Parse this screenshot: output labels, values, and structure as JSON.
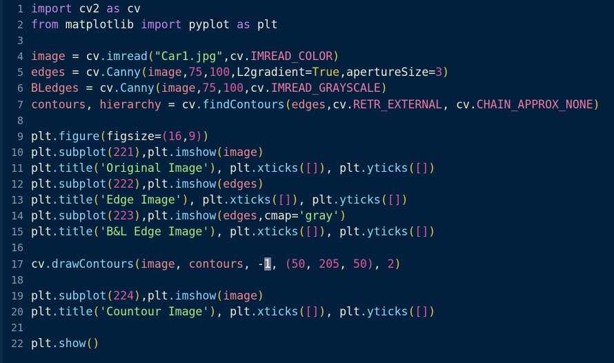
{
  "editor": {
    "background_color": "#04203f",
    "language": "python",
    "total_lines": 22,
    "selection": {
      "text": "1",
      "line": 17,
      "highlight_color": "#7a8290"
    },
    "colors": {
      "keyword": "#c586e8",
      "function": "#8fd6f7",
      "string": "#aee87a",
      "number": "#e05a94",
      "variable": "#f08a8a",
      "paren": "#e8c547",
      "bracket": "#e05a94",
      "constant": "#f07a9e",
      "text": "#f2ead3",
      "line_number": "#9aa7b8"
    }
  },
  "lines": [
    {
      "n": "1",
      "text": "import cv2 as cv"
    },
    {
      "n": "2",
      "text": "from matplotlib import pyplot as plt"
    },
    {
      "n": "3",
      "text": ""
    },
    {
      "n": "4",
      "text": "image = cv.imread(\"Car1.jpg\",cv.IMREAD_COLOR)"
    },
    {
      "n": "5",
      "text": "edges = cv.Canny(image,75,100,L2gradient=True,apertureSize=3)"
    },
    {
      "n": "6",
      "text": "BLedges = cv.Canny(image,75,100,cv.IMREAD_GRAYSCALE)"
    },
    {
      "n": "7",
      "text": "contours, hierarchy = cv.findContours(edges,cv.RETR_EXTERNAL, cv.CHAIN_APPROX_NONE)"
    },
    {
      "n": "8",
      "text": ""
    },
    {
      "n": "9",
      "text": "plt.figure(figsize=(16,9))"
    },
    {
      "n": "10",
      "text": "plt.subplot(221),plt.imshow(image)"
    },
    {
      "n": "11",
      "text": "plt.title('Original Image'), plt.xticks([]), plt.yticks([])"
    },
    {
      "n": "12",
      "text": "plt.subplot(222),plt.imshow(edges)"
    },
    {
      "n": "13",
      "text": "plt.title('Edge Image'), plt.xticks([]), plt.yticks([])"
    },
    {
      "n": "14",
      "text": "plt.subplot(223),plt.imshow(edges,cmap='gray')"
    },
    {
      "n": "15",
      "text": "plt.title('B&L Edge Image'), plt.xticks([]), plt.yticks([])"
    },
    {
      "n": "16",
      "text": ""
    },
    {
      "n": "17",
      "text": "cv.drawContours(image, contours, -1, (50, 205, 50), 2)"
    },
    {
      "n": "18",
      "text": ""
    },
    {
      "n": "19",
      "text": "plt.subplot(224),plt.imshow(image)"
    },
    {
      "n": "20",
      "text": "plt.title('Countour Image'), plt.xticks([]), plt.yticks([])"
    },
    {
      "n": "21",
      "text": ""
    },
    {
      "n": "22",
      "text": "plt.show()"
    }
  ],
  "tokens": {
    "l1": [
      [
        "import",
        "t-kw"
      ],
      [
        " ",
        "t-plain"
      ],
      [
        "cv2",
        "t-plain"
      ],
      [
        " ",
        "t-plain"
      ],
      [
        "as",
        "t-kw"
      ],
      [
        " ",
        "t-plain"
      ],
      [
        "cv",
        "t-plain"
      ]
    ],
    "l2": [
      [
        "from",
        "t-kw"
      ],
      [
        " ",
        "t-plain"
      ],
      [
        "matplotlib",
        "t-plain"
      ],
      [
        " ",
        "t-plain"
      ],
      [
        "import",
        "t-kw"
      ],
      [
        " ",
        "t-plain"
      ],
      [
        "pyplot",
        "t-plain"
      ],
      [
        " ",
        "t-plain"
      ],
      [
        "as",
        "t-kw"
      ],
      [
        " ",
        "t-plain"
      ],
      [
        "plt",
        "t-plain"
      ]
    ],
    "l3": [],
    "l4": [
      [
        "image",
        "t-const"
      ],
      [
        " = ",
        "t-plain"
      ],
      [
        "cv",
        "t-plain"
      ],
      [
        ".imread",
        "t-fn"
      ],
      [
        "(",
        "t-paren"
      ],
      [
        "\"Car1.jpg\"",
        "t-str"
      ],
      [
        ",",
        "t-plain"
      ],
      [
        "cv",
        "t-plain"
      ],
      [
        ".",
        "t-plain"
      ],
      [
        "IMREAD_COLOR",
        "t-attr"
      ],
      [
        ")",
        "t-paren"
      ]
    ],
    "l5": [
      [
        "edges",
        "t-const"
      ],
      [
        " = ",
        "t-plain"
      ],
      [
        "cv",
        "t-plain"
      ],
      [
        ".Canny",
        "t-fn"
      ],
      [
        "(",
        "t-paren"
      ],
      [
        "image",
        "t-const"
      ],
      [
        ",",
        "t-plain"
      ],
      [
        "75",
        "t-num"
      ],
      [
        ",",
        "t-plain"
      ],
      [
        "100",
        "t-num"
      ],
      [
        ",",
        "t-plain"
      ],
      [
        "L2gradient",
        "t-plain"
      ],
      [
        "=",
        "t-plain"
      ],
      [
        "True",
        "t-bool"
      ],
      [
        ",",
        "t-plain"
      ],
      [
        "apertureSize",
        "t-plain"
      ],
      [
        "=",
        "t-plain"
      ],
      [
        "3",
        "t-num"
      ],
      [
        ")",
        "t-paren"
      ]
    ],
    "l6": [
      [
        "BLedges",
        "t-const"
      ],
      [
        " = ",
        "t-plain"
      ],
      [
        "cv",
        "t-plain"
      ],
      [
        ".Canny",
        "t-fn"
      ],
      [
        "(",
        "t-paren"
      ],
      [
        "image",
        "t-const"
      ],
      [
        ",",
        "t-plain"
      ],
      [
        "75",
        "t-num"
      ],
      [
        ",",
        "t-plain"
      ],
      [
        "100",
        "t-num"
      ],
      [
        ",",
        "t-plain"
      ],
      [
        "cv",
        "t-plain"
      ],
      [
        ".",
        "t-plain"
      ],
      [
        "IMREAD_GRAYSCALE",
        "t-attr"
      ],
      [
        ")",
        "t-paren"
      ]
    ],
    "l7": [
      [
        "contours",
        "t-const"
      ],
      [
        ", ",
        "t-plain"
      ],
      [
        "hierarchy",
        "t-const"
      ],
      [
        " = ",
        "t-plain"
      ],
      [
        "cv",
        "t-plain"
      ],
      [
        ".findContours",
        "t-fn"
      ],
      [
        "(",
        "t-paren"
      ],
      [
        "edges",
        "t-const"
      ],
      [
        ",",
        "t-plain"
      ],
      [
        "cv",
        "t-plain"
      ],
      [
        ".",
        "t-plain"
      ],
      [
        "RETR_EXTERNAL",
        "t-attr"
      ],
      [
        ", ",
        "t-plain"
      ],
      [
        "cv",
        "t-plain"
      ],
      [
        ".",
        "t-plain"
      ],
      [
        "CHAIN_APPROX_NONE",
        "t-attr"
      ],
      [
        ")",
        "t-paren"
      ]
    ],
    "l8": [],
    "l9": [
      [
        "plt",
        "t-plain"
      ],
      [
        ".figure",
        "t-fn"
      ],
      [
        "(",
        "t-paren"
      ],
      [
        "figsize",
        "t-plain"
      ],
      [
        "=",
        "t-plain"
      ],
      [
        "(",
        "t-brk"
      ],
      [
        "16",
        "t-num"
      ],
      [
        ",",
        "t-plain"
      ],
      [
        "9",
        "t-num"
      ],
      [
        ")",
        "t-brk"
      ],
      [
        ")",
        "t-paren"
      ]
    ],
    "l10": [
      [
        "plt",
        "t-plain"
      ],
      [
        ".subplot",
        "t-fn"
      ],
      [
        "(",
        "t-paren"
      ],
      [
        "221",
        "t-num"
      ],
      [
        ")",
        "t-paren"
      ],
      [
        ",",
        "t-plain"
      ],
      [
        "plt",
        "t-plain"
      ],
      [
        ".imshow",
        "t-fn"
      ],
      [
        "(",
        "t-paren"
      ],
      [
        "image",
        "t-const"
      ],
      [
        ")",
        "t-paren"
      ]
    ],
    "l11": [
      [
        "plt",
        "t-plain"
      ],
      [
        ".title",
        "t-fn"
      ],
      [
        "(",
        "t-paren"
      ],
      [
        "'Original Image'",
        "t-str"
      ],
      [
        ")",
        "t-paren"
      ],
      [
        ", ",
        "t-plain"
      ],
      [
        "plt",
        "t-plain"
      ],
      [
        ".xticks",
        "t-fn"
      ],
      [
        "(",
        "t-paren"
      ],
      [
        "[]",
        "t-brk"
      ],
      [
        ")",
        "t-paren"
      ],
      [
        ", ",
        "t-plain"
      ],
      [
        "plt",
        "t-plain"
      ],
      [
        ".yticks",
        "t-fn"
      ],
      [
        "(",
        "t-paren"
      ],
      [
        "[]",
        "t-brk"
      ],
      [
        ")",
        "t-paren"
      ]
    ],
    "l12": [
      [
        "plt",
        "t-plain"
      ],
      [
        ".subplot",
        "t-fn"
      ],
      [
        "(",
        "t-paren"
      ],
      [
        "222",
        "t-num"
      ],
      [
        ")",
        "t-paren"
      ],
      [
        ",",
        "t-plain"
      ],
      [
        "plt",
        "t-plain"
      ],
      [
        ".imshow",
        "t-fn"
      ],
      [
        "(",
        "t-paren"
      ],
      [
        "edges",
        "t-const"
      ],
      [
        ")",
        "t-paren"
      ]
    ],
    "l13": [
      [
        "plt",
        "t-plain"
      ],
      [
        ".title",
        "t-fn"
      ],
      [
        "(",
        "t-paren"
      ],
      [
        "'Edge Image'",
        "t-str"
      ],
      [
        ")",
        "t-paren"
      ],
      [
        ", ",
        "t-plain"
      ],
      [
        "plt",
        "t-plain"
      ],
      [
        ".xticks",
        "t-fn"
      ],
      [
        "(",
        "t-paren"
      ],
      [
        "[]",
        "t-brk"
      ],
      [
        ")",
        "t-paren"
      ],
      [
        ", ",
        "t-plain"
      ],
      [
        "plt",
        "t-plain"
      ],
      [
        ".yticks",
        "t-fn"
      ],
      [
        "(",
        "t-paren"
      ],
      [
        "[]",
        "t-brk"
      ],
      [
        ")",
        "t-paren"
      ]
    ],
    "l14": [
      [
        "plt",
        "t-plain"
      ],
      [
        ".subplot",
        "t-fn"
      ],
      [
        "(",
        "t-paren"
      ],
      [
        "223",
        "t-num"
      ],
      [
        ")",
        "t-paren"
      ],
      [
        ",",
        "t-plain"
      ],
      [
        "plt",
        "t-plain"
      ],
      [
        ".imshow",
        "t-fn"
      ],
      [
        "(",
        "t-paren"
      ],
      [
        "edges",
        "t-const"
      ],
      [
        ",",
        "t-plain"
      ],
      [
        "cmap",
        "t-plain"
      ],
      [
        "=",
        "t-plain"
      ],
      [
        "'gray'",
        "t-str"
      ],
      [
        ")",
        "t-paren"
      ]
    ],
    "l15": [
      [
        "plt",
        "t-plain"
      ],
      [
        ".title",
        "t-fn"
      ],
      [
        "(",
        "t-paren"
      ],
      [
        "'B&L Edge Image'",
        "t-str"
      ],
      [
        ")",
        "t-paren"
      ],
      [
        ", ",
        "t-plain"
      ],
      [
        "plt",
        "t-plain"
      ],
      [
        ".xticks",
        "t-fn"
      ],
      [
        "(",
        "t-paren"
      ],
      [
        "[]",
        "t-brk"
      ],
      [
        ")",
        "t-paren"
      ],
      [
        ", ",
        "t-plain"
      ],
      [
        "plt",
        "t-plain"
      ],
      [
        ".yticks",
        "t-fn"
      ],
      [
        "(",
        "t-paren"
      ],
      [
        "[]",
        "t-brk"
      ],
      [
        ")",
        "t-paren"
      ]
    ],
    "l16": [],
    "l17": [
      [
        "cv",
        "t-plain"
      ],
      [
        ".drawContours",
        "t-fn"
      ],
      [
        "(",
        "t-paren"
      ],
      [
        "image",
        "t-const"
      ],
      [
        ", ",
        "t-plain"
      ],
      [
        "contours",
        "t-const"
      ],
      [
        ", ",
        "t-plain"
      ],
      [
        "-",
        "t-plain"
      ],
      [
        "1",
        "sel"
      ],
      [
        ", ",
        "t-plain"
      ],
      [
        "(",
        "t-brk"
      ],
      [
        "50",
        "t-num"
      ],
      [
        ", ",
        "t-plain"
      ],
      [
        "205",
        "t-num"
      ],
      [
        ", ",
        "t-plain"
      ],
      [
        "50",
        "t-num"
      ],
      [
        ")",
        "t-brk"
      ],
      [
        ", ",
        "t-plain"
      ],
      [
        "2",
        "t-num"
      ],
      [
        ")",
        "t-paren"
      ]
    ],
    "l18": [],
    "l19": [
      [
        "plt",
        "t-plain"
      ],
      [
        ".subplot",
        "t-fn"
      ],
      [
        "(",
        "t-paren"
      ],
      [
        "224",
        "t-num"
      ],
      [
        ")",
        "t-paren"
      ],
      [
        ",",
        "t-plain"
      ],
      [
        "plt",
        "t-plain"
      ],
      [
        ".imshow",
        "t-fn"
      ],
      [
        "(",
        "t-paren"
      ],
      [
        "image",
        "t-const"
      ],
      [
        ")",
        "t-paren"
      ]
    ],
    "l20": [
      [
        "plt",
        "t-plain"
      ],
      [
        ".title",
        "t-fn"
      ],
      [
        "(",
        "t-paren"
      ],
      [
        "'Countour Image'",
        "t-str"
      ],
      [
        ")",
        "t-paren"
      ],
      [
        ", ",
        "t-plain"
      ],
      [
        "plt",
        "t-plain"
      ],
      [
        ".xticks",
        "t-fn"
      ],
      [
        "(",
        "t-paren"
      ],
      [
        "[]",
        "t-brk"
      ],
      [
        ")",
        "t-paren"
      ],
      [
        ", ",
        "t-plain"
      ],
      [
        "plt",
        "t-plain"
      ],
      [
        ".yticks",
        "t-fn"
      ],
      [
        "(",
        "t-paren"
      ],
      [
        "[]",
        "t-brk"
      ],
      [
        ")",
        "t-paren"
      ]
    ],
    "l21": [],
    "l22": [
      [
        "plt",
        "t-plain"
      ],
      [
        ".show",
        "t-fn"
      ],
      [
        "(",
        "t-paren"
      ],
      [
        ")",
        "t-paren"
      ]
    ]
  }
}
